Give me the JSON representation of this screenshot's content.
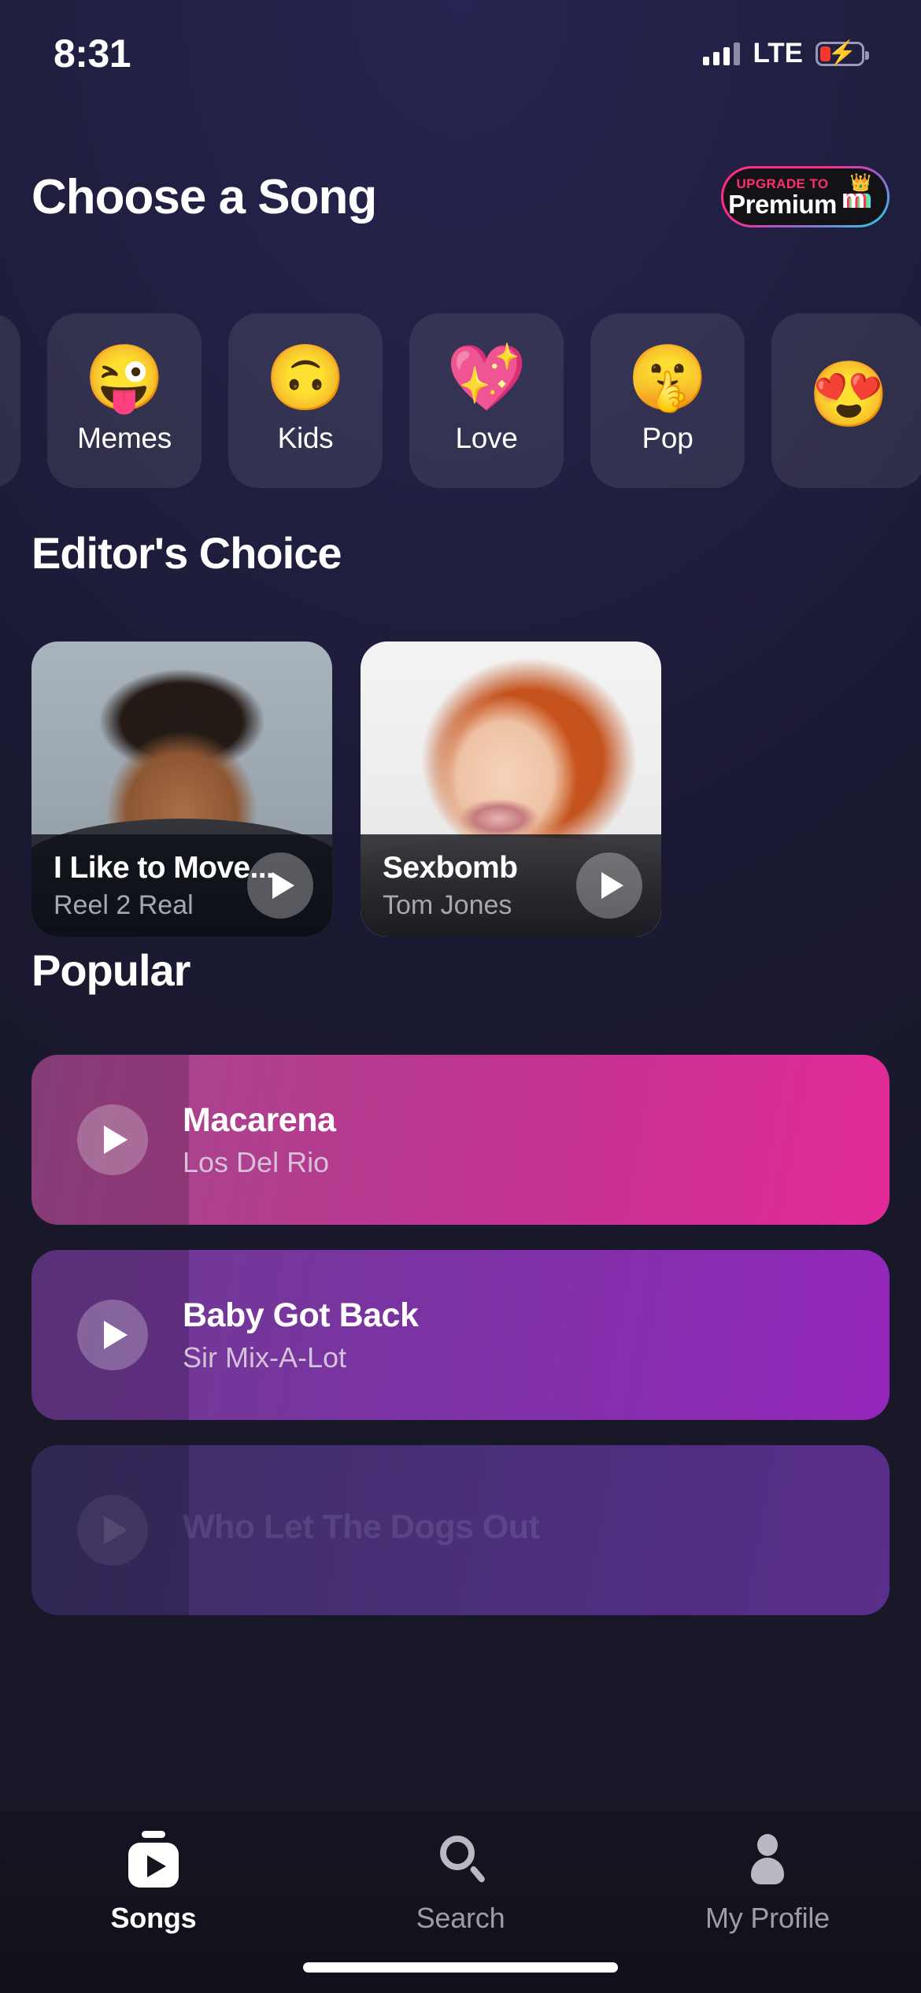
{
  "statusbar": {
    "time": "8:31",
    "network": "LTE",
    "signal_icon": "signal-bars-icon",
    "battery_icon": "battery-charging-icon"
  },
  "header": {
    "title": "Choose a Song",
    "premium": {
      "upgrade_label": "UPGRADE TO",
      "plan_label": "Premium",
      "logo_icon": "crowned-m-logo-icon",
      "crown_glyph": "👑",
      "letter": "m"
    }
  },
  "categories": [
    {
      "label": "Memes",
      "emoji": "😜",
      "icon": "face-with-tongue-icon"
    },
    {
      "label": "Kids",
      "emoji": "🙃",
      "icon": "upside-down-face-icon"
    },
    {
      "label": "Love",
      "emoji": "💖",
      "icon": "sparkling-heart-icon"
    },
    {
      "label": "Pop",
      "emoji": "🤫",
      "icon": "shushing-face-icon"
    }
  ],
  "editors_choice": {
    "title": "Editor's Choice",
    "cards": [
      {
        "title": "I Like to Move...",
        "artist": "Reel 2 Real",
        "play_icon": "play-icon"
      },
      {
        "title": "Sexbomb",
        "artist": "Tom Jones",
        "play_icon": "play-icon"
      }
    ]
  },
  "popular": {
    "title": "Popular",
    "items": [
      {
        "title": "Macarena",
        "artist": "Los Del Rio",
        "play_icon": "play-icon",
        "color": "#e22a96"
      },
      {
        "title": "Baby Got Back",
        "artist": "Sir Mix-A-Lot",
        "play_icon": "play-icon",
        "color": "#9426bb"
      },
      {
        "title": "Who Let The Dogs Out",
        "artist": "",
        "play_icon": "play-icon",
        "color": "#5a2e8c"
      }
    ]
  },
  "tabbar": {
    "tabs": [
      {
        "label": "Songs",
        "icon": "songs-video-icon",
        "active": true
      },
      {
        "label": "Search",
        "icon": "search-icon",
        "active": false
      },
      {
        "label": "My Profile",
        "icon": "person-icon",
        "active": false
      }
    ]
  },
  "theme": {
    "background": "#201f40",
    "accent_pink": "#ff2f6d",
    "accent_cyan": "#22d3e0",
    "battery_red": "#f6372d"
  }
}
